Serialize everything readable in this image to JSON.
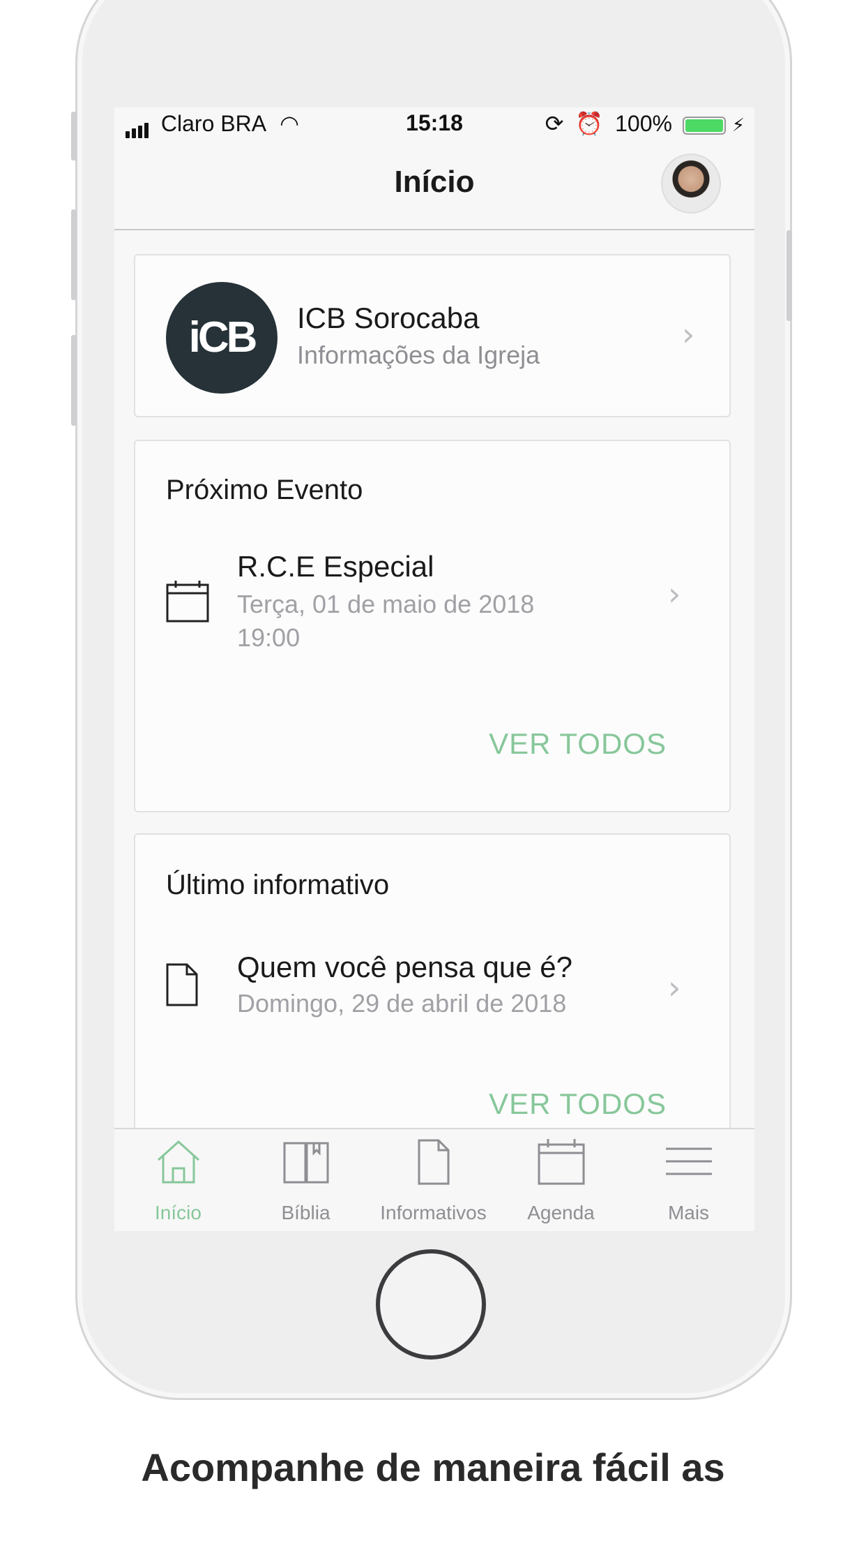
{
  "status_bar": {
    "carrier": "Claro BRA",
    "time": "15:18",
    "battery": "100%"
  },
  "navbar": {
    "title": "Início"
  },
  "church_card": {
    "logo_text": "iCB",
    "name": "ICB Sorocaba",
    "subtitle": "Informações da Igreja"
  },
  "event_card": {
    "section_title": "Próximo Evento",
    "title": "R.C.E Especial",
    "date": "Terça, 01 de maio de 2018",
    "time": "19:00",
    "see_all": "VER TODOS"
  },
  "newsletter_card": {
    "section_title": "Último informativo",
    "title": "Quem você pensa que é?",
    "date": "Domingo, 29 de abril de 2018",
    "see_all": "VER TODOS"
  },
  "tabs": [
    {
      "label": "Início",
      "icon": "home-icon",
      "active": true
    },
    {
      "label": "Bíblia",
      "icon": "book-icon",
      "active": false
    },
    {
      "label": "Informativos",
      "icon": "document-icon",
      "active": false
    },
    {
      "label": "Agenda",
      "icon": "calendar-icon",
      "active": false
    },
    {
      "label": "Mais",
      "icon": "menu-icon",
      "active": false
    }
  ],
  "colors": {
    "accent": "#87c79a",
    "inactive": "#8e8e93",
    "logo_bg": "#263238"
  },
  "caption": "Acompanhe de maneira fácil as"
}
